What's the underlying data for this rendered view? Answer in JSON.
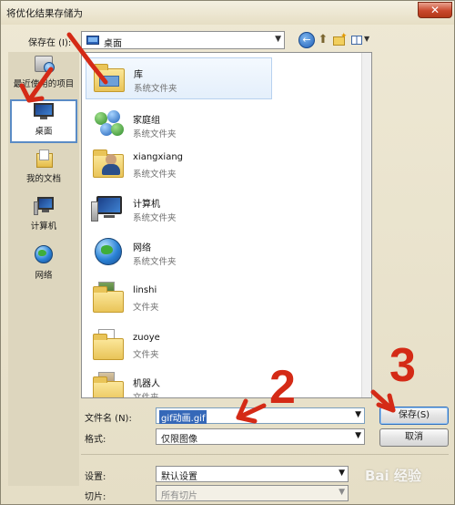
{
  "window": {
    "title": "将优化结果存储为",
    "close_label": "✕"
  },
  "toolbar": {
    "save_in_label": "保存在 (I):",
    "location": "桌面",
    "back_icon": "back-arrow-icon",
    "up_icon": "up-folder-icon",
    "new_folder_icon": "new-folder-icon",
    "views_icon": "view-menu-icon"
  },
  "places": [
    {
      "label": "最近使用的项目",
      "icon": "recent-items-icon"
    },
    {
      "label": "桌面",
      "icon": "desktop-icon",
      "active": true
    },
    {
      "label": "我的文档",
      "icon": "documents-icon"
    },
    {
      "label": "计算机",
      "icon": "computer-icon"
    },
    {
      "label": "网络",
      "icon": "network-icon"
    }
  ],
  "files": [
    {
      "name": "库",
      "type": "系统文件夹",
      "icon": "library-icon"
    },
    {
      "name": "家庭组",
      "type": "系统文件夹",
      "icon": "homegroup-icon"
    },
    {
      "name": "xiangxiang",
      "type": "系统文件夹",
      "icon": "user-folder-icon"
    },
    {
      "name": "计算机",
      "type": "系统文件夹",
      "icon": "computer-icon"
    },
    {
      "name": "网络",
      "type": "系统文件夹",
      "icon": "network-icon"
    },
    {
      "name": "linshi",
      "type": "文件夹",
      "icon": "folder-icon"
    },
    {
      "name": "zuoye",
      "type": "文件夹",
      "icon": "folder-icon"
    },
    {
      "name": "机器人",
      "type": "文件夹",
      "icon": "folder-icon"
    }
  ],
  "form": {
    "filename_label": "文件名 (N):",
    "filename_value": "gif动画.gif",
    "format_label": "格式:",
    "format_value": "仅限图像",
    "settings_label": "设置:",
    "settings_value": "默认设置",
    "slices_label": "切片:",
    "slices_value": "所有切片"
  },
  "buttons": {
    "save": "保存(S)",
    "cancel": "取消"
  },
  "annotations": [
    "2",
    "3"
  ],
  "watermark": "Bai 经验",
  "colors": {
    "annotation_red": "#d42a16",
    "selection_blue": "#3568b8"
  }
}
